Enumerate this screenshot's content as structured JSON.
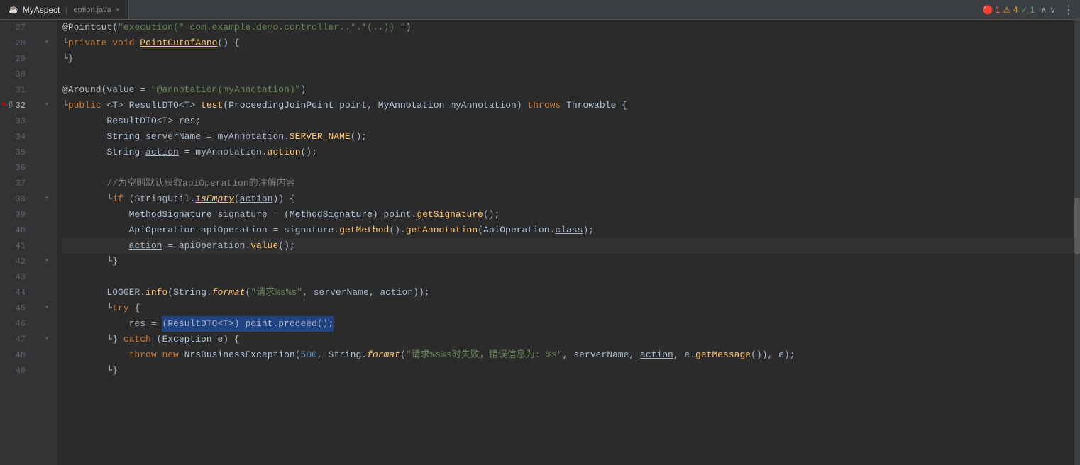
{
  "tab": {
    "label": "MyAspect",
    "file": "eption.java",
    "close_label": "×"
  },
  "breadcrumb": {
    "text": "MyAspect"
  },
  "badges": {
    "errors": "🔴 1",
    "warnings": "⚠ 4",
    "ok": "✓ 1",
    "nav_up": "∧",
    "nav_down": "∨"
  },
  "lines": [
    {
      "num": "27",
      "content": "@Pointcut(\"execution(* com.example.demo.controller..*.*(..)) \")"
    },
    {
      "num": "28",
      "content": "private void PointCutofAnno() {",
      "fold": true
    },
    {
      "num": "29",
      "content": "}"
    },
    {
      "num": "30",
      "content": ""
    },
    {
      "num": "31",
      "content": "@Around(value = \"@annotation(myAnnotation)\")"
    },
    {
      "num": "32",
      "content": "public <T> ResultDTO<T> test(ProceedingJoinPoint point, MyAnnotation myAnnotation) throws Throwable {",
      "fold": true,
      "has_debug": true
    },
    {
      "num": "33",
      "content": "    ResultDTO<T> res;"
    },
    {
      "num": "34",
      "content": "    String serverName = myAnnotation.SERVER_NAME();"
    },
    {
      "num": "35",
      "content": "    String action = myAnnotation.action();"
    },
    {
      "num": "36",
      "content": ""
    },
    {
      "num": "37",
      "content": "    //为空则默认获取apiOperation的注解内容"
    },
    {
      "num": "38",
      "content": "    if (StringUtil.isEmpty(action)) {",
      "fold": true
    },
    {
      "num": "39",
      "content": "        MethodSignature signature = (MethodSignature) point.getSignature();"
    },
    {
      "num": "40",
      "content": "        ApiOperation apiOperation = signature.getMethod().getAnnotation(ApiOperation.class);"
    },
    {
      "num": "41",
      "content": "        action = apiOperation.value();",
      "active": true
    },
    {
      "num": "42",
      "content": "    }",
      "fold": true
    },
    {
      "num": "43",
      "content": ""
    },
    {
      "num": "44",
      "content": "    LOGGER.info(String.format(\"请求%s%s\", serverName, action));"
    },
    {
      "num": "45",
      "content": "    try {",
      "fold": true
    },
    {
      "num": "46",
      "content": "        res = (ResultDTO<T>) point.proceed();"
    },
    {
      "num": "47",
      "content": "    } catch (Exception e) {",
      "fold": true
    },
    {
      "num": "48",
      "content": "        throw new NrsBusinessException(500, String.format(\"请求%s%s时失败，错误信息为: %s\", serverName, action, e.getMessage()), e);"
    },
    {
      "num": "49",
      "content": "    }"
    }
  ]
}
